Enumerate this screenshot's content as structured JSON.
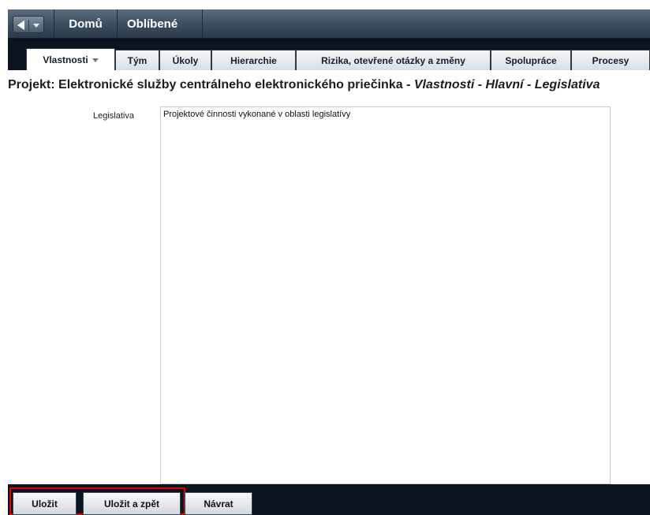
{
  "header": {
    "home_label": "Domů",
    "favorites_label": "Oblíbené"
  },
  "tabs": [
    {
      "label": "Vlastnosti",
      "active": true,
      "has_dropdown": true
    },
    {
      "label": "Tým"
    },
    {
      "label": "Úkoly"
    },
    {
      "label": "Hierarchie"
    },
    {
      "label": "Rizika, otevřené otázky a změny"
    },
    {
      "label": "Spolupráce"
    },
    {
      "label": "Procesy"
    }
  ],
  "page": {
    "title_prefix": "Projekt: Elektronické služby centrálneho elektronického priečinka - ",
    "title_context": "Vlastnosti - Hlavní - Legislativa"
  },
  "form": {
    "legislativa_label": "Legislativa",
    "legislativa_value": "Projektové činnosti vykonané v oblasti legislatívy"
  },
  "footer": {
    "save_label": "Uložit",
    "save_back_label": "Uložit a zpět",
    "return_label": "Návrat"
  },
  "colors": {
    "frame": "#0b1420",
    "highlight": "#e00000"
  },
  "icons": [
    "back-arrow-icon",
    "history-dropdown-icon",
    "tab-dropdown-icon"
  ]
}
